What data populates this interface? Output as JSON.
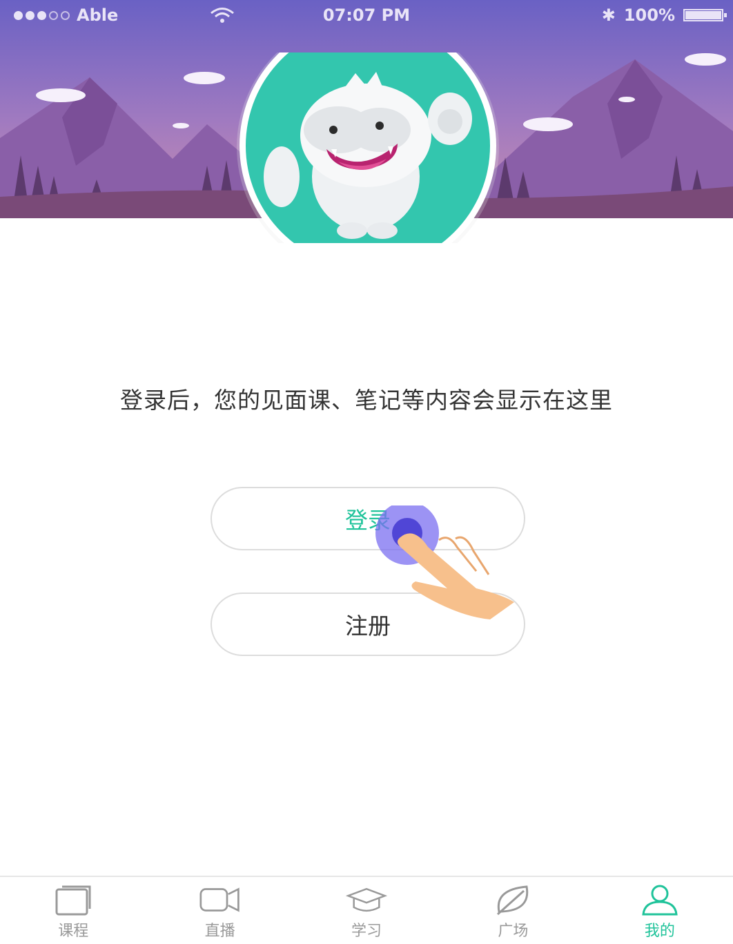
{
  "status_bar": {
    "carrier": "Able",
    "time": "07:07 PM",
    "battery": "100%",
    "battery_level": 1.0
  },
  "message": "登录后，您的见面课、笔记等内容会显示在这里",
  "buttons": {
    "login_label": "登录",
    "register_label": "注册"
  },
  "tabbar": {
    "items": [
      {
        "label": "课程",
        "icon": "course-icon"
      },
      {
        "label": "直播",
        "icon": "live-video-icon"
      },
      {
        "label": "学习",
        "icon": "graduation-cap-icon"
      },
      {
        "label": "广场",
        "icon": "leaf-icon"
      },
      {
        "label": "我的",
        "icon": "user-icon"
      }
    ],
    "active_index": 4
  },
  "colors": {
    "accent": "#1fc39a",
    "header_top": "#6a61c4",
    "header_bottom": "#c27aa6",
    "avatar_bg": "#33c6ae",
    "tap_ring": "#7b6ff0"
  }
}
